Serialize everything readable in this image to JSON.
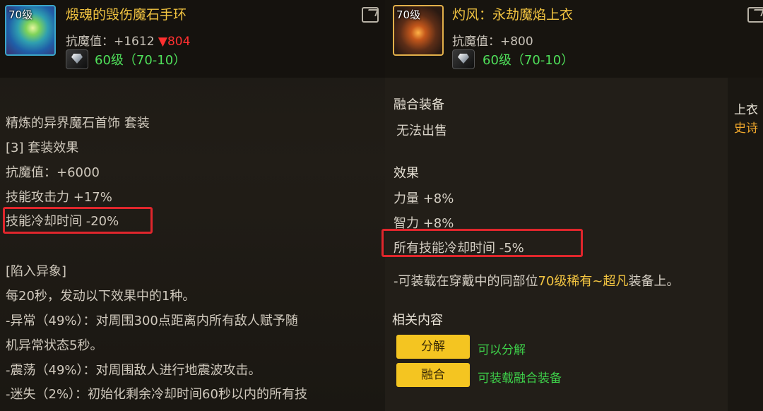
{
  "left_item": {
    "level_badge": "70级",
    "name": "煅魂的毁伤魔石手环",
    "stat_label": "抗魔值：+1612 ",
    "stat_down": "▼804",
    "level_range": "60级（70-10）",
    "set_name": "精炼的异界魔石首饰 套装",
    "set_effect_title": "[3] 套装效果",
    "lines": [
      "抗魔值：+6000",
      "技能攻击力 +17%",
      "技能冷却时间 -20%",
      "[陷入异象]",
      "每20秒，发动以下效果中的1种。",
      "-异常（49%）：对周围300点距离内所有敌人赋予随",
      "机异常状态5秒。",
      "-震荡（49%）：对周围敌人进行地震波攻击。",
      "-迷失（2%）：初始化剩余冷却时间60秒以内的所有技"
    ]
  },
  "right_item": {
    "level_badge": "70级",
    "name": "灼风：永劫魔焰上衣",
    "stat_label": "抗魔值：+800",
    "level_range": "60级（70-10）",
    "fusion_title": "融合装备",
    "fusion_note": "无法出售",
    "effect_title": "效果",
    "effects": [
      "力量 +8%",
      "智力 +8%",
      "所有技能冷却时间 -5%"
    ],
    "mount_prefix": "-可装载在穿戴中的同部位",
    "mount_highlight": "70级稀有~超凡",
    "mount_suffix": "装备上。",
    "related_title": "相关内容",
    "buttons": [
      {
        "label": "分解",
        "note": "可以分解"
      },
      {
        "label": "融合",
        "note": "可装载融合装备"
      }
    ]
  },
  "far_right": {
    "slot": "上衣",
    "rarity": "史诗"
  },
  "colors": {
    "name_gold": "#f2c441",
    "level_green": "#4fe05a",
    "down_red": "#ff3030",
    "highlight_box": "#e0262c",
    "button_yellow": "#f4c521"
  },
  "icons": [
    "bracelet-item-icon",
    "armor-item-icon",
    "gem-icon",
    "share-icon"
  ]
}
